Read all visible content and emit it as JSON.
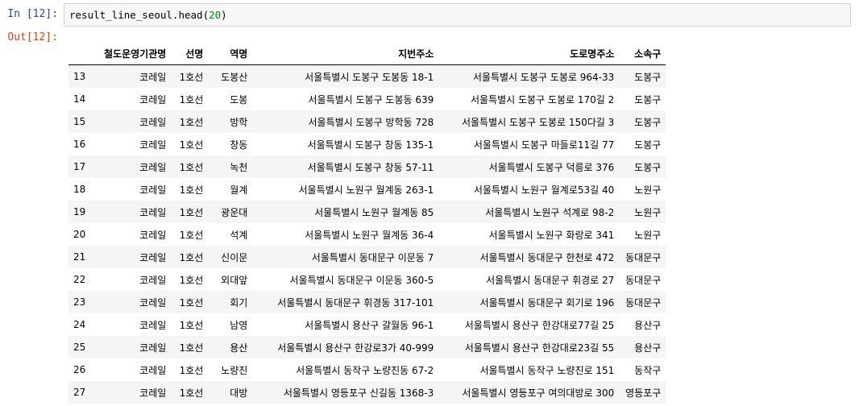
{
  "input_prompt": "In [12]:",
  "output_prompt": "Out[12]:",
  "code": {
    "name": "result_line_seoul.head(",
    "arg": "20",
    "close": ")"
  },
  "table": {
    "columns": [
      "",
      "철도운영기관명",
      "선명",
      "역명",
      "지번주소",
      "도로명주소",
      "소속구"
    ],
    "rows": [
      [
        "13",
        "코레일",
        "1호선",
        "도봉산",
        "서울특별시 도봉구 도봉동 18-1",
        "서울특별시 도봉구 도봉로 964-33",
        "도봉구"
      ],
      [
        "14",
        "코레일",
        "1호선",
        "도봉",
        "서울특별시 도봉구 도봉동 639",
        "서울특별시 도봉구 도봉로 170길 2",
        "도봉구"
      ],
      [
        "15",
        "코레일",
        "1호선",
        "방학",
        "서울특별시 도봉구 방학동 728",
        "서울특별시 도봉구 도봉로 150다길 3",
        "도봉구"
      ],
      [
        "16",
        "코레일",
        "1호선",
        "창동",
        "서울특별시 도봉구 창동 135-1",
        "서울특별시 도봉구 마들로11길 77",
        "도봉구"
      ],
      [
        "17",
        "코레일",
        "1호선",
        "녹천",
        "서울특별시 도봉구 창동 57-11",
        "서울특별시 도봉구 덕릉로 376",
        "도봉구"
      ],
      [
        "18",
        "코레일",
        "1호선",
        "월계",
        "서울특별시 노원구 월계동 263-1",
        "서울특별시 노원구 월계로53길 40",
        "노원구"
      ],
      [
        "19",
        "코레일",
        "1호선",
        "광운대",
        "서울특별시 노원구 월계동 85",
        "서울특별시 노원구 석계로 98-2",
        "노원구"
      ],
      [
        "20",
        "코레일",
        "1호선",
        "석계",
        "서울특별시 노원구 월계동 36-4",
        "서울특별시 노원구 화랑로 341",
        "노원구"
      ],
      [
        "21",
        "코레일",
        "1호선",
        "신이문",
        "서울특별시 동대문구 이문동 7",
        "서울특별시 동대문구 한천로 472",
        "동대문구"
      ],
      [
        "22",
        "코레일",
        "1호선",
        "외대앞",
        "서울특별시 동대문구 이문동 360-5",
        "서울특별시 동대문구 휘경로 27",
        "동대문구"
      ],
      [
        "23",
        "코레일",
        "1호선",
        "회기",
        "서울특별시 동대문구 휘경동 317-101",
        "서울특별시 동대문구 회기로 196",
        "동대문구"
      ],
      [
        "24",
        "코레일",
        "1호선",
        "남영",
        "서울특별시 용산구 갈월동 96-1",
        "서울특별시 용산구 한강대로77길 25",
        "용산구"
      ],
      [
        "25",
        "코레일",
        "1호선",
        "용산",
        "서울특별시 용산구 한강로3가 40-999",
        "서울특별시 용산구 한강대로23길 55",
        "용산구"
      ],
      [
        "26",
        "코레일",
        "1호선",
        "노량진",
        "서울특별시 동작구 노량진동 67-2",
        "서울특별시 동작구 노량진로 151",
        "동작구"
      ],
      [
        "27",
        "코레일",
        "1호선",
        "대방",
        "서울특별시 영등포구 신길동 1368-3",
        "서울특별시 영등포구 여의대방로 300",
        "영등포구"
      ]
    ]
  },
  "colors": {
    "in_prompt": "#303f9f",
    "out_prompt": "#d84315",
    "number_literal": "#008800",
    "cell_border": "#cfcfcf",
    "cell_background": "#f7f7f7",
    "row_stripe": "#f5f5f5"
  }
}
